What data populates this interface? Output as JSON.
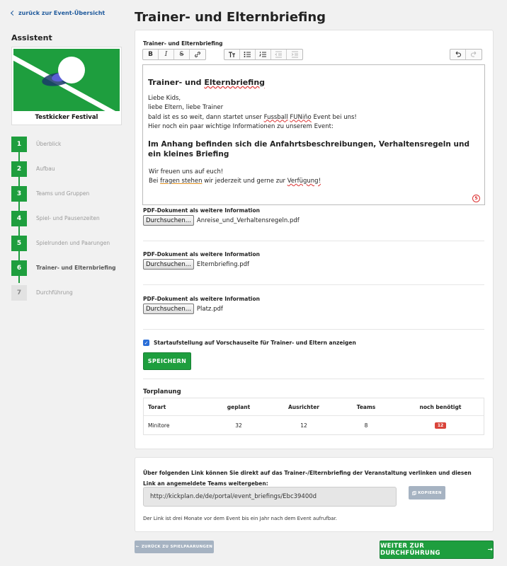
{
  "sidebar": {
    "back_link": "zurück zur Event-Übersicht",
    "heading": "Assistent",
    "event_name": "Testkicker Festival",
    "steps": [
      {
        "num": "1",
        "label": "Überblick"
      },
      {
        "num": "2",
        "label": "Aufbau"
      },
      {
        "num": "3",
        "label": "Teams und Gruppen"
      },
      {
        "num": "4",
        "label": "Spiel- und Pausenzeiten"
      },
      {
        "num": "5",
        "label": "Spielrunden und Paarungen"
      },
      {
        "num": "6",
        "label": "Trainer- und Elternbriefing"
      },
      {
        "num": "7",
        "label": "Durchführung"
      }
    ]
  },
  "main": {
    "title": "Trainer- und Elternbriefing",
    "editor_label": "Trainer- und Elternbriefing",
    "editor": {
      "heading_pre": "Trainer- und ",
      "heading_spell": "Elternbriefing",
      "line1": "Liebe Kids,",
      "line2": "liebe Eltern, liebe Trainer",
      "line3_pre": "bald ist es so weit, dann startet unser ",
      "line3_spell1": "Fussball",
      "line3_space": " ",
      "line3_spell2": "FUNiño",
      "line3_post": " Event bei uns!",
      "line4": "Hier noch ein paar wichtige Informationen zu unserem Event:",
      "subheading": "Im Anhang befinden sich die Anfahrtsbeschreibungen, Verhaltensregeln und ein kleines Briefing",
      "line5": "Wir freuen uns auf euch!",
      "line6_pre": "Bei ",
      "line6_spell": "fragen stehen",
      "line6_mid": " wir jederzeit und gerne zur ",
      "line6_end": "Verfügung!",
      "counter": "5"
    },
    "attachments": [
      {
        "label": "PDF-Dokument als weitere Information",
        "button": "Durchsuchen...",
        "file": "Anreise_und_Verhaltensregeln.pdf"
      },
      {
        "label": "PDF-Dokument als weitere Information",
        "button": "Durchsuchen...",
        "file": "Elternbriefing.pdf"
      },
      {
        "label": "PDF-Dokument als weitere Information",
        "button": "Durchsuchen...",
        "file": "Platz.pdf"
      }
    ],
    "checkbox_label": "Startaufstellung auf Vorschauseite für Trainer- und Eltern anzeigen",
    "save_button": "SPEICHERN",
    "torplanung": {
      "title": "Torplanung",
      "headers": [
        "Torart",
        "geplant",
        "Ausrichter",
        "Teams",
        "noch benötigt"
      ],
      "rows": [
        [
          "Minitore",
          "32",
          "12",
          "8",
          "12"
        ]
      ]
    }
  },
  "link_section": {
    "text": "Über folgenden Link können Sie direkt auf das Trainer-/Elternbriefing der Veranstaltung verlinken und diesen Link an angemeldete Teams weitergeben:",
    "url": "http://kickplan.de/de/portal/event_briefings/Ebc39400d",
    "copy_button": "KOPIEREN",
    "note": "Der Link ist drei Monate vor dem Event bis ein Jahr nach dem Event aufrufbar."
  },
  "footer": {
    "back_button": "ZURÜCK ZU SPIELPAARUNGEN",
    "next_button": "WEITER ZUR DURCHFÜHRUNG"
  },
  "colors": {
    "primary_green": "#1e9e3e",
    "link_blue": "#1f5a9c",
    "badge_red": "#d9443a",
    "muted_button": "#a6b3c2"
  },
  "icons": [
    "chevron-left-icon",
    "bold-icon",
    "italic-icon",
    "strikethrough-icon",
    "link-icon",
    "text-size-icon",
    "bullet-list-icon",
    "numbered-list-icon",
    "outdent-icon",
    "indent-icon",
    "undo-icon",
    "redo-icon",
    "copy-icon",
    "arrow-right-icon",
    "arrow-left-icon"
  ]
}
